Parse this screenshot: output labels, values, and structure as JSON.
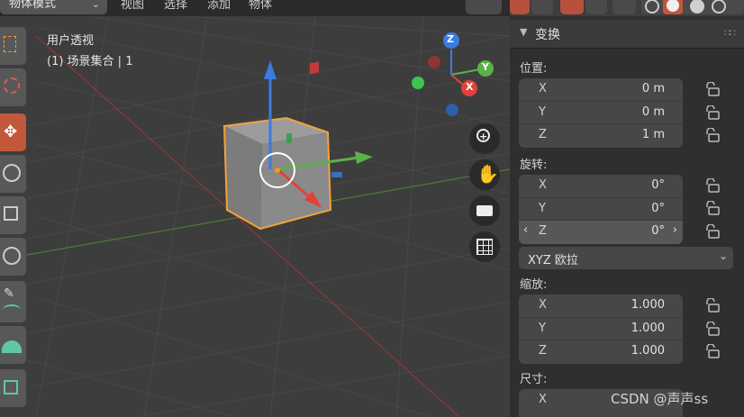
{
  "header": {
    "mode": "物体模式",
    "menu": [
      "视图",
      "选择",
      "添加",
      "物体"
    ]
  },
  "viewport": {
    "title": "用户透视",
    "subtitle": "(1) 场景集合 | 1",
    "gizmo": {
      "z": "Z",
      "y": "Y",
      "x": "X"
    },
    "nav_icons": [
      "zoom-icon",
      "hand-pan-icon",
      "camera-icon",
      "grid-icon"
    ]
  },
  "panel": {
    "title": "变换",
    "location": {
      "label": "位置:",
      "x": "0 m",
      "y": "0 m",
      "z": "1 m"
    },
    "rotation": {
      "label": "旋转:",
      "x": "0°",
      "y": "0°",
      "z": "0°",
      "mode": "XYZ 欧拉"
    },
    "scale": {
      "label": "缩放:",
      "x": "1.000",
      "y": "1.000",
      "z": "1.000"
    },
    "dimensions": {
      "label": "尺寸:",
      "x": ""
    },
    "axes": {
      "x": "X",
      "y": "Y",
      "z": "Z"
    }
  },
  "watermark": "CSDN @声声ss",
  "colors": {
    "active_tool": "#c2573b",
    "selection": "#f2a33a",
    "x_axis": "#e0413c",
    "y_axis": "#5bb14a",
    "z_axis": "#3b7be0"
  }
}
